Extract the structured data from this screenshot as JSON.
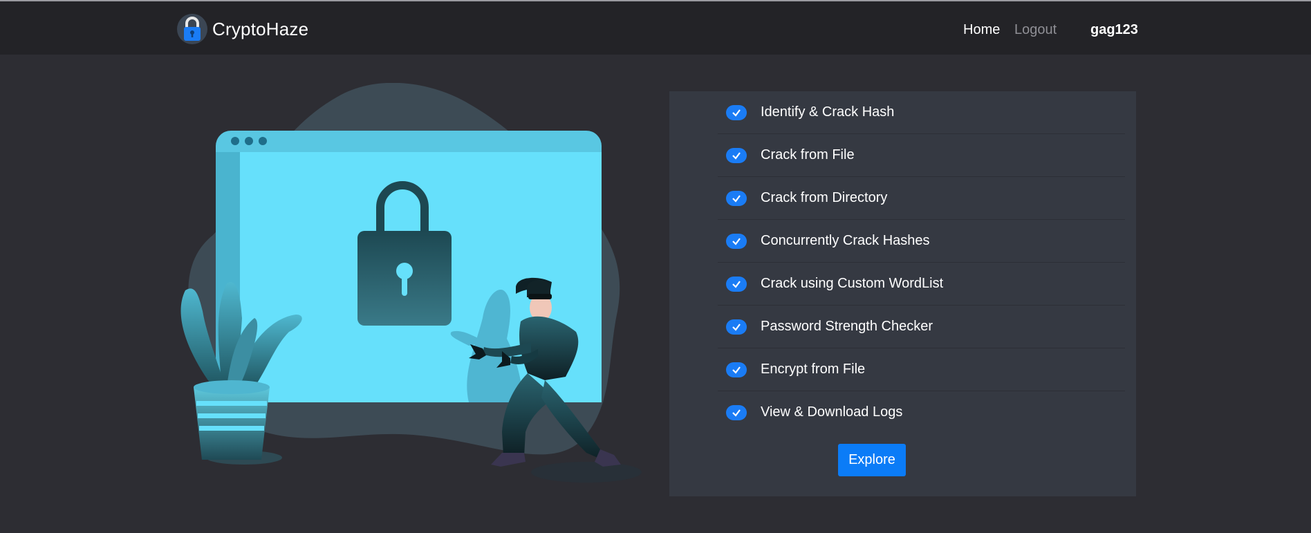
{
  "brand": {
    "name": "CryptoHaze",
    "logo_icon": "padlock-icon"
  },
  "nav": {
    "home_label": "Home",
    "logout_label": "Logout",
    "username": "gag123"
  },
  "features": [
    {
      "label": "Identify & Crack Hash",
      "checked": true
    },
    {
      "label": "Crack from File",
      "checked": true
    },
    {
      "label": "Crack from Directory",
      "checked": true
    },
    {
      "label": "Concurrently Crack Hashes",
      "checked": true
    },
    {
      "label": "Crack using Custom WordList",
      "checked": true
    },
    {
      "label": "Password Strength Checker",
      "checked": true
    },
    {
      "label": "Encrypt from File",
      "checked": true
    },
    {
      "label": "View & Download Logs",
      "checked": true
    }
  ],
  "explore_label": "Explore",
  "colors": {
    "background": "#2d2d33",
    "navbar": "#232327",
    "panel": "#353942",
    "accent": "#0b7cf7",
    "illustration_primary": "#66e0fb"
  }
}
